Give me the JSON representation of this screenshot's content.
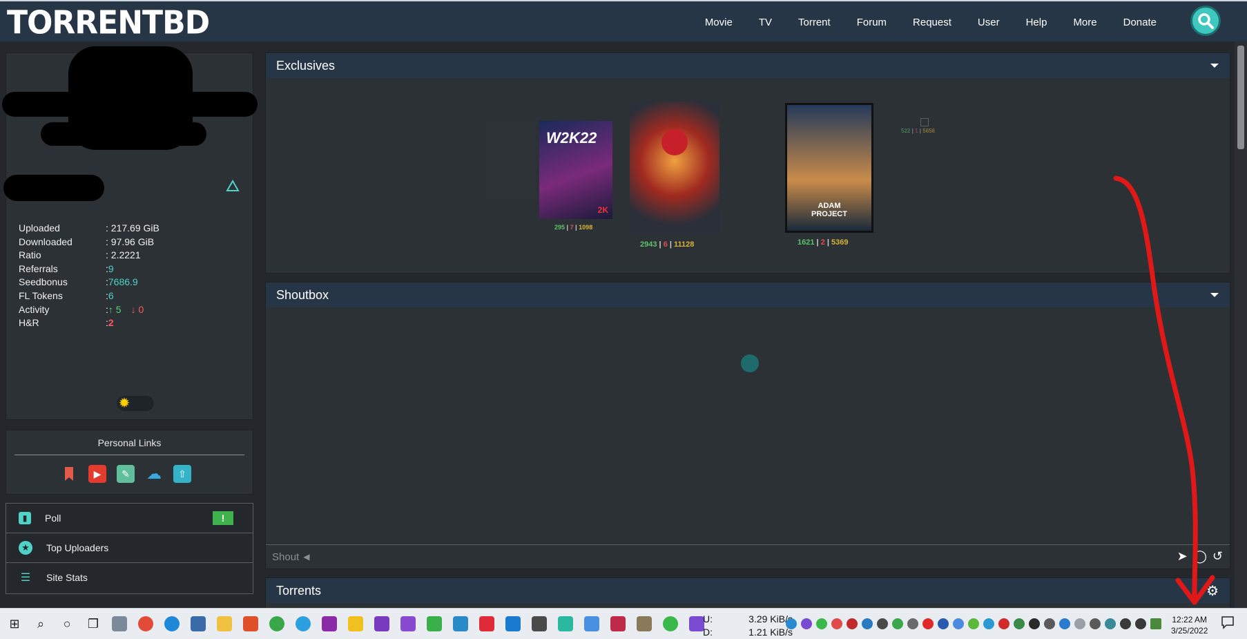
{
  "header": {
    "logo": "TORRENTBD",
    "nav": [
      "Movie",
      "TV",
      "Torrent",
      "Forum",
      "Request",
      "User",
      "Help",
      "More",
      "Donate"
    ]
  },
  "user": {
    "stats": [
      {
        "label": "Uploaded",
        "value": ": 217.69 GiB"
      },
      {
        "label": "Downloaded",
        "value": ": 97.96 GiB"
      },
      {
        "label": "Ratio",
        "value": ": 2.2221"
      },
      {
        "label": "Referrals",
        "value": ": ",
        "accent": "9"
      },
      {
        "label": "Seedbonus",
        "value": ": ",
        "accent": "7686.9"
      },
      {
        "label": "FL Tokens",
        "value": ": ",
        "accent": "6"
      },
      {
        "label": "Activity",
        "value": ": ",
        "up": "↑ 5",
        "down": "↓ 0"
      },
      {
        "label": "H&R",
        "value": ": ",
        "hr": "2"
      }
    ]
  },
  "personal_links": {
    "title": "Personal Links"
  },
  "menu": [
    {
      "label": "Poll",
      "badge": "!"
    },
    {
      "label": "Top Uploaders"
    },
    {
      "label": "Site Stats"
    }
  ],
  "exclusives": {
    "title": "Exclusives",
    "items": [
      {
        "seed": "295",
        "leech": "7",
        "done": "1098"
      },
      {
        "seed": "2943",
        "leech": "6",
        "done": "11128"
      },
      {
        "seed": "1621",
        "leech": "2",
        "done": "5369"
      },
      {
        "seed": "522",
        "leech": "1",
        "done": "5656"
      }
    ]
  },
  "shoutbox": {
    "title": "Shoutbox",
    "placeholder": "Shout"
  },
  "torrents": {
    "title": "Torrents"
  },
  "taskbar": {
    "up_label": "U:",
    "up_value": "3.29 KiB/s",
    "down_label": "D:",
    "down_value": "1.21 KiB/s",
    "time": "12:22 AM",
    "date": "3/25/2022"
  },
  "colors": {
    "accent": "#4fd3c8",
    "header": "#273646",
    "panel": "#2c3135",
    "background": "#24282c"
  }
}
